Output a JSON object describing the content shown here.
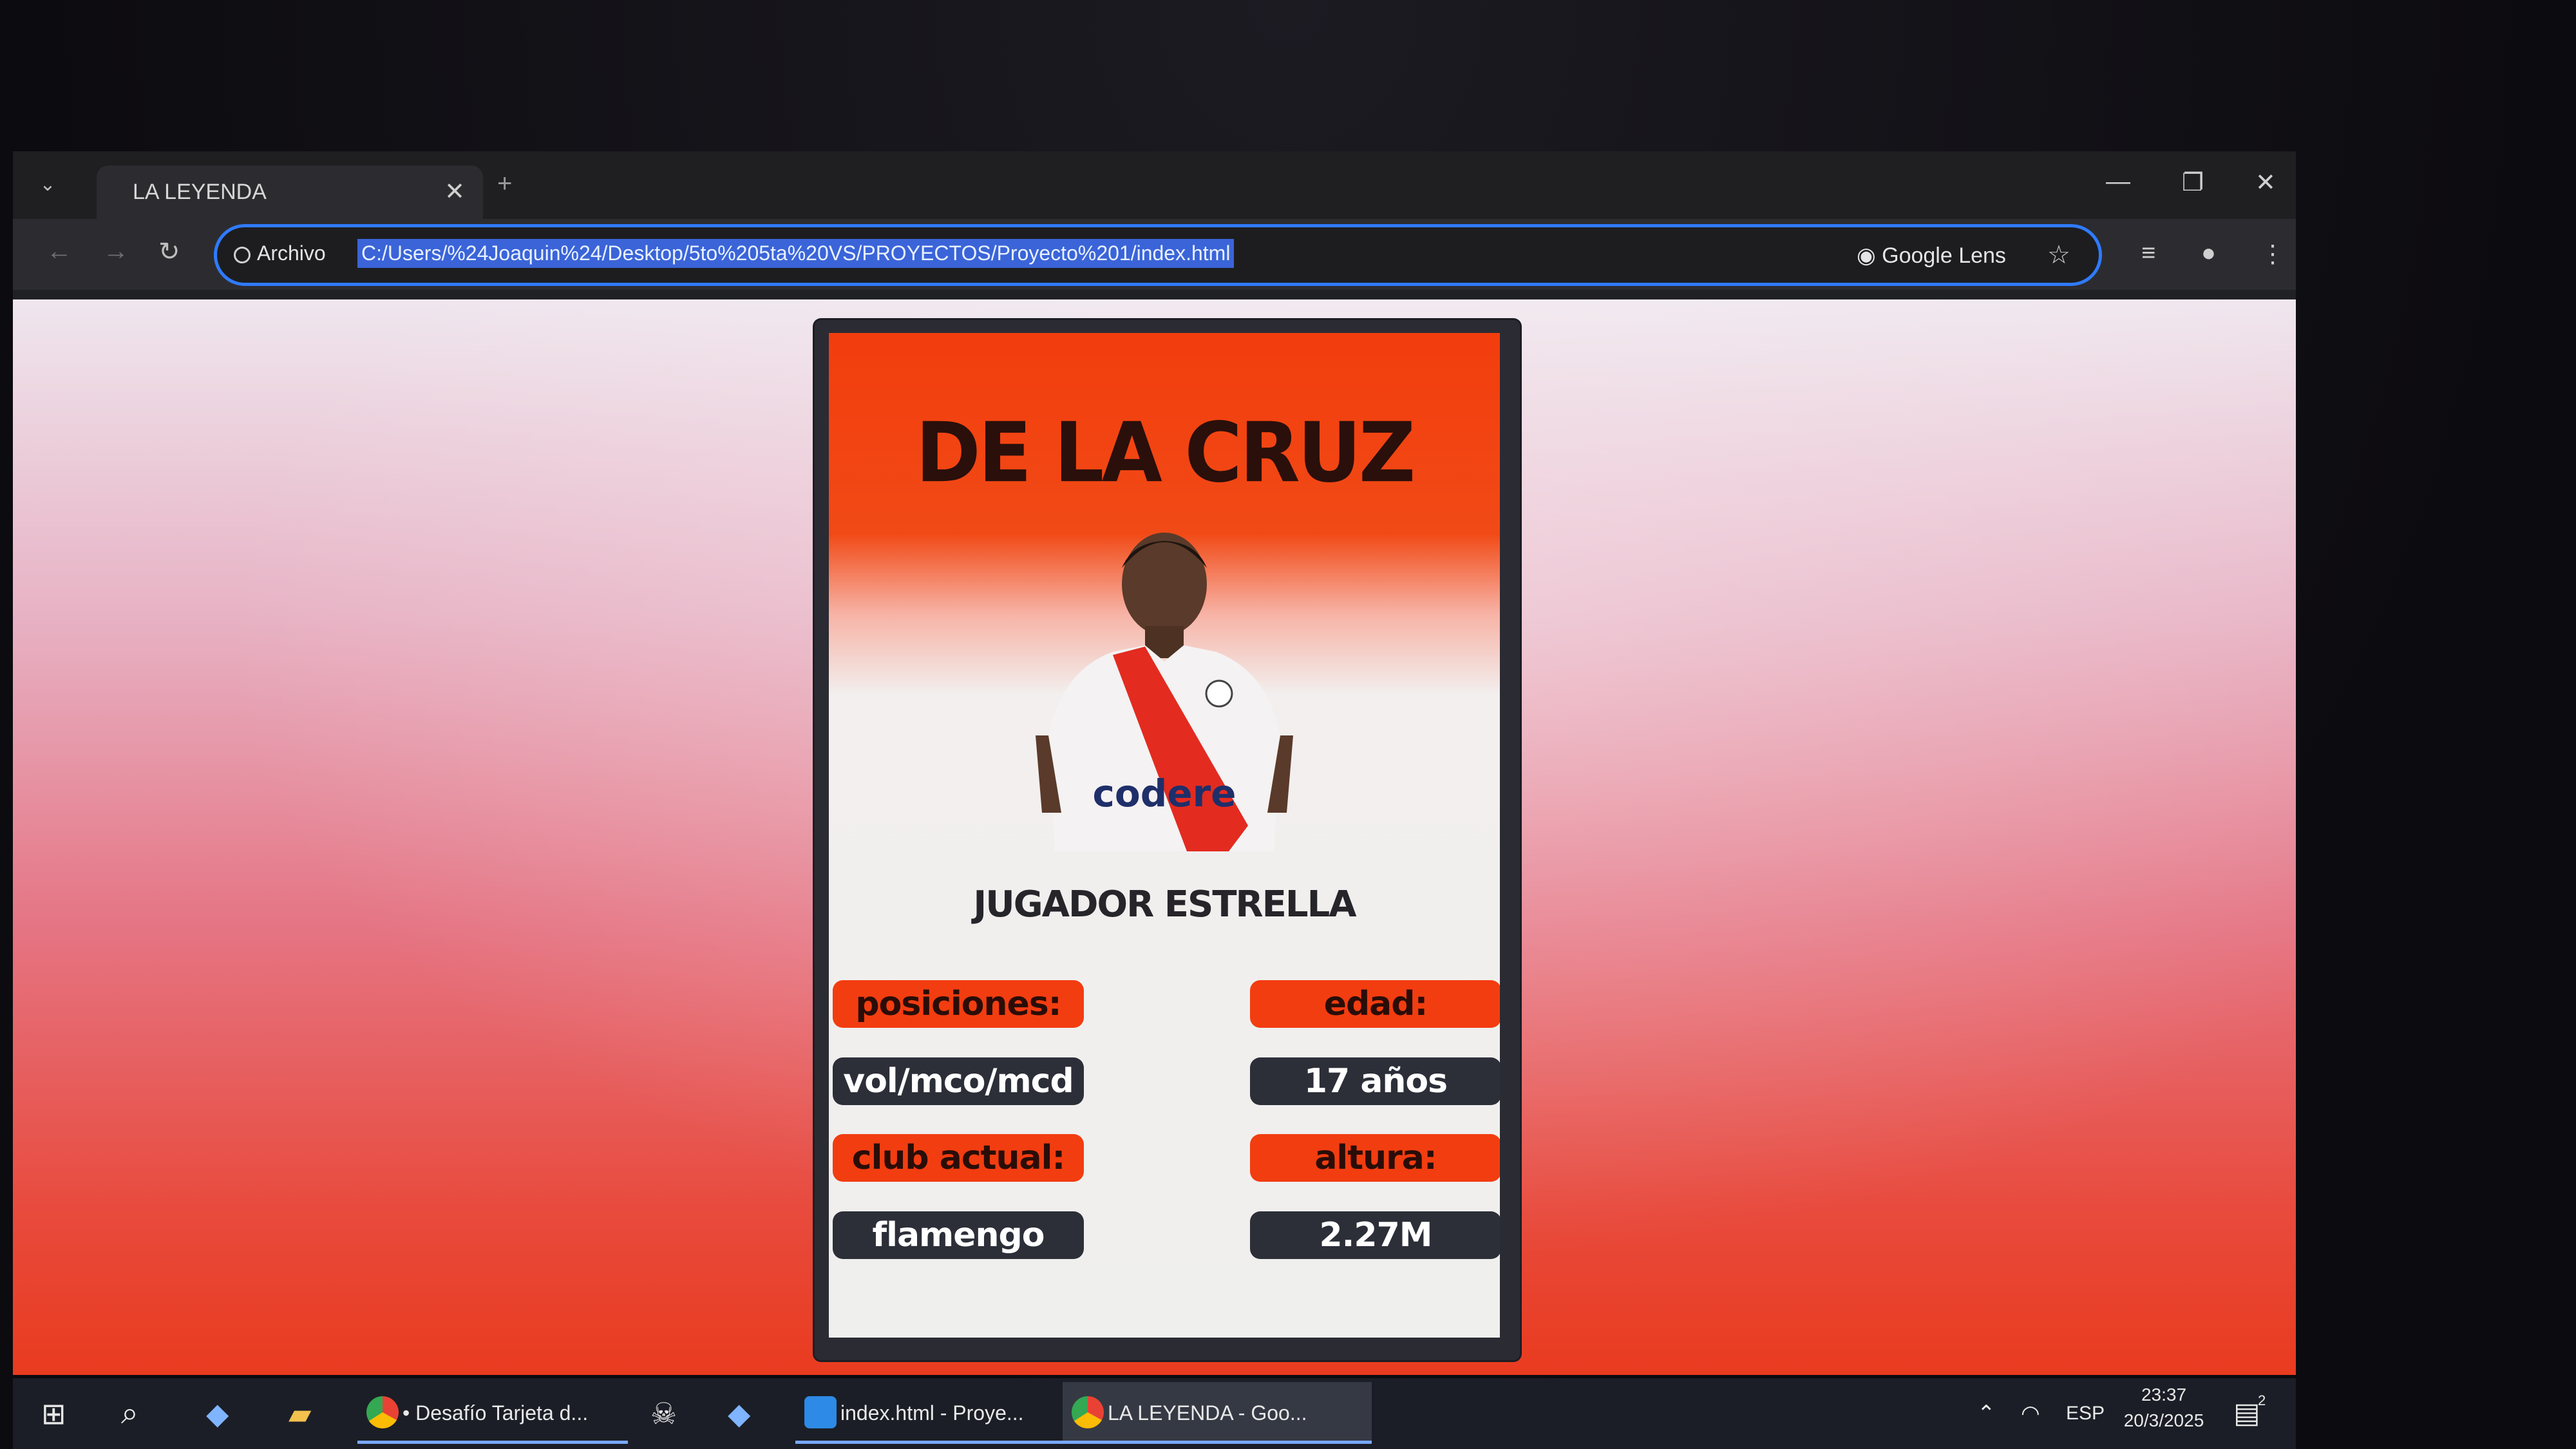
{
  "browser": {
    "tab_title": "LA LEYENDA",
    "tab_close": "✕",
    "new_tab": "+",
    "site_info": "Archivo",
    "url": "C:/Users/%24Joaquin%24/Desktop/5to%205ta%20VS/PROYECTOS/Proyecto%201/index.html",
    "lens_label": "Google Lens"
  },
  "card": {
    "player_name": "DE LA CRUZ",
    "subtitle": "JUGADOR ESTRELLA",
    "stats": [
      {
        "label": "posiciones:",
        "value": "vol/mco/mcd"
      },
      {
        "label": "edad:",
        "value": "17 años"
      },
      {
        "label": "club actual:",
        "value": "flamengo"
      },
      {
        "label": "altura:",
        "value": "2.27M"
      }
    ],
    "jersey_sponsor": "codere",
    "colors": {
      "accent": "#f23d10",
      "dark_pill": "#2c2f38"
    }
  },
  "taskbar": {
    "apps": [
      {
        "label": "• Desafío Tarjeta d...",
        "icon": "chrome-icon"
      },
      {
        "label": "index.html - Proye...",
        "icon": "vscode-icon"
      },
      {
        "label": "LA LEYENDA - Goo...",
        "icon": "chrome-icon"
      }
    ],
    "language": "ESP",
    "time": "23:37",
    "date": "20/3/2025",
    "notifications": "2"
  }
}
